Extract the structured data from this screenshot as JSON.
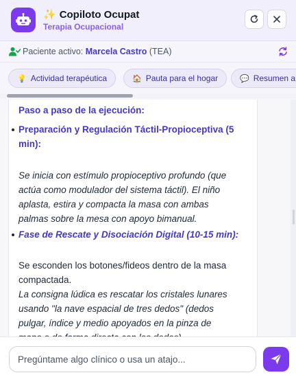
{
  "header": {
    "title": "Copiloto Ocupat",
    "subtitle": "Terapia Ocupacional",
    "avatar_icon": "robot-icon",
    "sparkle_icon": "sparkle-icon",
    "refresh_icon": "refresh-icon",
    "close_icon": "close-icon"
  },
  "patient": {
    "label": "Paciente activo:",
    "name": "Marcela Castro",
    "condition": "(TEA)",
    "icon": "user-check-icon",
    "sync_icon": "sync-icon"
  },
  "shortcuts": [
    {
      "label": "Actividad terapéutica",
      "icon": "lightbulb-icon"
    },
    {
      "label": "Pauta para el hogar",
      "icon": "house-icon"
    },
    {
      "label": "Resumen ap",
      "icon": "speech-bubble-icon"
    }
  ],
  "message": {
    "heading": "Paso a paso de la ejecución:",
    "step1_title": [
      "Preparación y Regulación Táctil-Propioceptiva (5",
      "min):"
    ],
    "step1_body": [
      "Se inicia con estímulo propioceptivo profundo (que",
      "actúa como modulador del sistema táctil). El niño",
      "aplasta, estira y compacta la masa con ambas",
      "palmas sobre la mesa con apoyo bimanual."
    ],
    "step2_title": "Fase de Rescate y Disociación Digital (10-15 min):",
    "step2_body": [
      "Se esconden los botones/fideos dentro de la masa",
      "compactada."
    ],
    "step2_italic": [
      "La consigna lúdica es rescatar los cristales lunares",
      "usando \"la nave espacial de tres dedos\" (dedos",
      "pulgar, índice y medio apoyados en la pinza de",
      "mano o de forma directa con los dedos)."
    ]
  },
  "composer": {
    "placeholder": "Pregúntame algo clínico o usa un atajo...",
    "send_icon": "send-icon"
  },
  "colors": {
    "accent": "#7c3aed",
    "heading": "#4338ca",
    "header_bg": "#f1effc"
  }
}
